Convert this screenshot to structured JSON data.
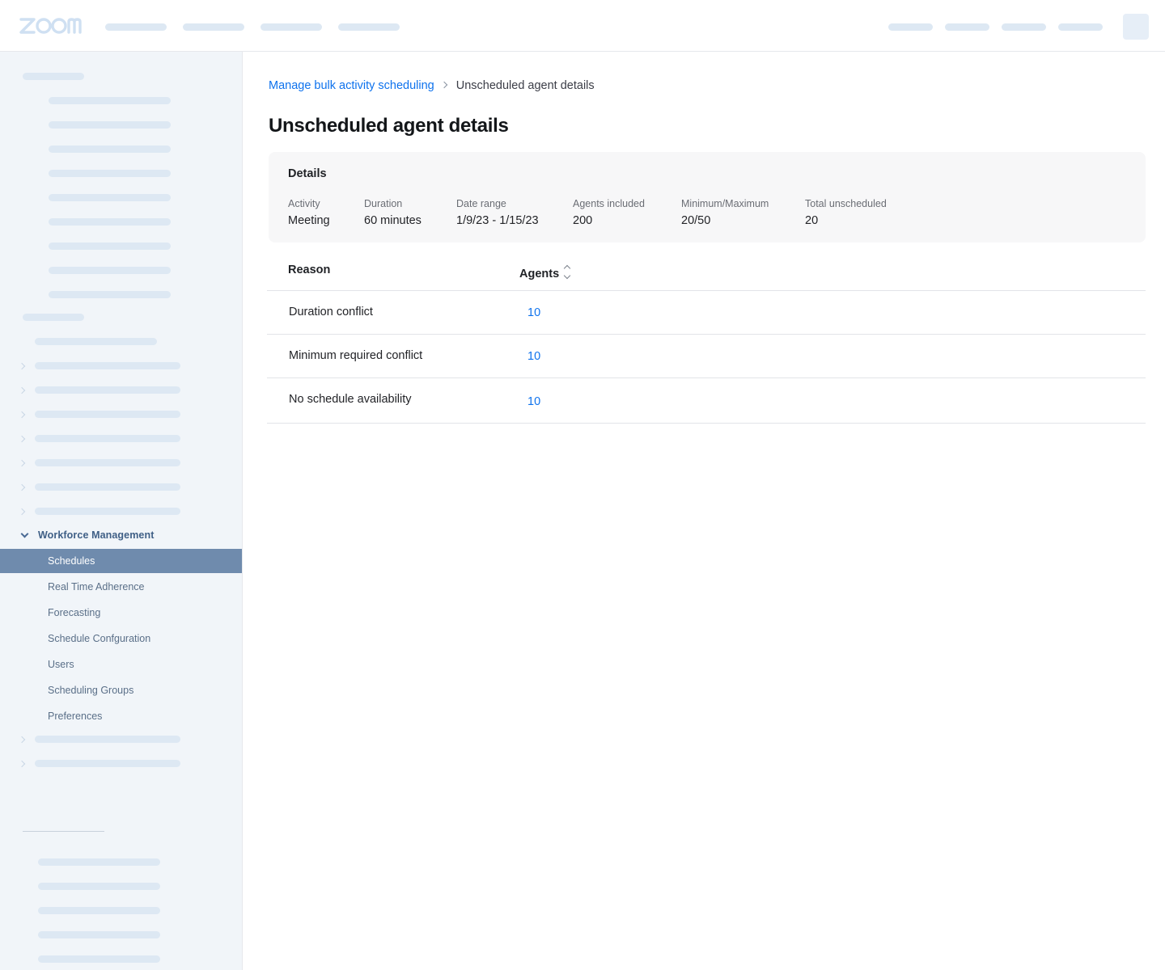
{
  "brand": {
    "logo_text": "zoom",
    "accent": "#0e72ed",
    "sidebar_active_bg": "#6f8bad",
    "placeholder_color": "#dde8f3"
  },
  "topnav": {
    "placeholder_items": 4,
    "right_placeholder_items": 4,
    "avatar": "user-avatar"
  },
  "sidebar": {
    "group": {
      "label": "Workforce Management",
      "icon": "chevron-down-icon",
      "expanded": true
    },
    "items": [
      {
        "label": "Schedules",
        "active": true
      },
      {
        "label": "Real Time Adherence",
        "active": false
      },
      {
        "label": "Forecasting",
        "active": false
      },
      {
        "label": "Schedule Confguration",
        "active": false
      },
      {
        "label": "Users",
        "active": false
      },
      {
        "label": "Scheduling Groups",
        "active": false
      },
      {
        "label": "Preferences",
        "active": false
      }
    ]
  },
  "breadcrumb": {
    "parent": "Manage bulk activity scheduling",
    "separator_icon": "chevron-right-icon",
    "current": "Unscheduled agent details"
  },
  "page": {
    "title": "Unscheduled agent details"
  },
  "details": {
    "heading": "Details",
    "fields": [
      {
        "label": "Activity",
        "value": "Meeting"
      },
      {
        "label": "Duration",
        "value": "60 minutes"
      },
      {
        "label": "Date range",
        "value": "1/9/23 - 1/15/23"
      },
      {
        "label": "Agents included",
        "value": "200"
      },
      {
        "label": "Minimum/Maximum",
        "value": "20/50"
      },
      {
        "label": "Total unscheduled",
        "value": "20"
      }
    ]
  },
  "table": {
    "columns": {
      "reason": "Reason",
      "agents": "Agents",
      "sort_icon": "sort-icon"
    },
    "rows": [
      {
        "reason": "Duration conflict",
        "agents": "10"
      },
      {
        "reason": "Minimum required conflict",
        "agents": "10"
      },
      {
        "reason": "No schedule availability",
        "agents": "10"
      }
    ]
  }
}
